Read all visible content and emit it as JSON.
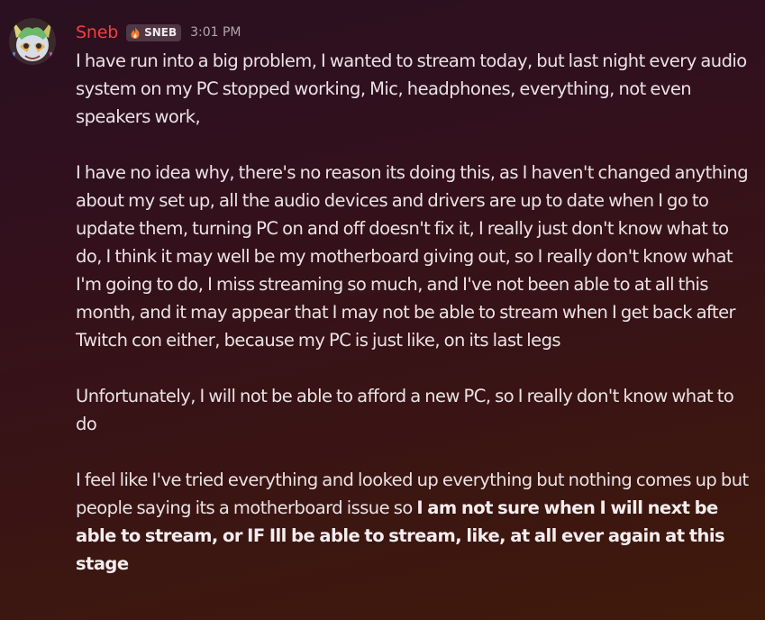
{
  "message": {
    "username": "Sneb",
    "tag": "SNEB",
    "tag_icon": "flame-icon",
    "timestamp": "3:01 PM",
    "avatar_icon": "avatar-image",
    "username_color": "#f23f42",
    "paragraphs": [
      {
        "text": "I have run into a big problem, I wanted to stream today, but last night every audio system on my PC stopped working, Mic, headphones, everything, not even speakers work,",
        "bold": ""
      },
      {
        "text": "I have no idea why, there's no reason its doing this, as I haven't changed anything about my set up, all the audio devices and drivers are up to date when I go to update them, turning PC on and off doesn't fix it, I really just don't know what to do, I think it may well be my motherboard giving out, so I really don't know what I'm going to do, I miss streaming so much, and I've not been able to at all this month, and it may appear that I may not be able to stream when I get back after Twitch con either, because my PC is just like, on its last legs",
        "bold": ""
      },
      {
        "text": "Unfortunately, I will not be able to afford a new PC, so I really don't know what to do",
        "bold": ""
      },
      {
        "text": "I feel like I've tried everything and looked up everything but nothing comes up but people saying its a motherboard issue so ",
        "bold": "I am not sure when I will next be able to stream, or IF Ill be able to stream, like, at all ever again at this stage"
      }
    ]
  }
}
